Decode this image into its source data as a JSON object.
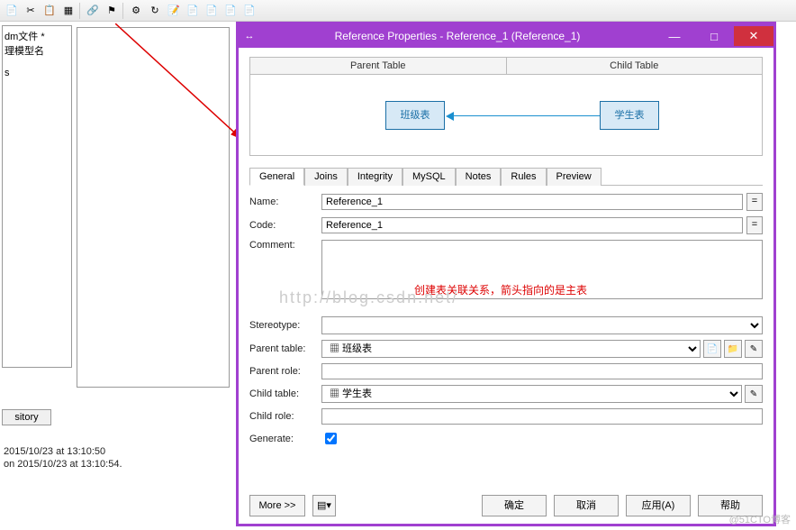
{
  "toolbar": {
    "icons": [
      "📄",
      "✂",
      "📋",
      "📊",
      "▦",
      "🔗",
      "⚙",
      "↻",
      "📝",
      "📄",
      "📄",
      "📄",
      "📄",
      "📄"
    ]
  },
  "tree": {
    "line1": "dm文件 *",
    "line2": "理模型名",
    "line3": "s"
  },
  "repo_tab": "sitory",
  "logs": {
    "l1": "2015/10/23 at 13:10:50",
    "l2": "on 2015/10/23 at 13:10:54."
  },
  "dialog": {
    "title": "Reference Properties - Reference_1 (Reference_1)",
    "parent_header": "Parent Table",
    "child_header": "Child Table",
    "entity_parent": "班级表",
    "entity_child": "学生表",
    "tabs": [
      "General",
      "Joins",
      "Integrity",
      "MySQL",
      "Notes",
      "Rules",
      "Preview"
    ],
    "labels": {
      "name": "Name:",
      "code": "Code:",
      "comment": "Comment:",
      "stereotype": "Stereotype:",
      "parent_table": "Parent table:",
      "parent_role": "Parent role:",
      "child_table": "Child table:",
      "child_role": "Child role:",
      "generate": "Generate:"
    },
    "values": {
      "name": "Reference_1",
      "code": "Reference_1",
      "parent_table": "班级表",
      "child_table": "学生表"
    },
    "comment_annotation": "创建表关联关系，箭头指向的是主表",
    "eq": "=",
    "buttons": {
      "more": "More >>",
      "ok": "确定",
      "cancel": "取消",
      "apply": "应用(A)",
      "help": "帮助"
    }
  },
  "watermark": "http://blog.csdn.net/",
  "watermark2": "@51CTO博客"
}
